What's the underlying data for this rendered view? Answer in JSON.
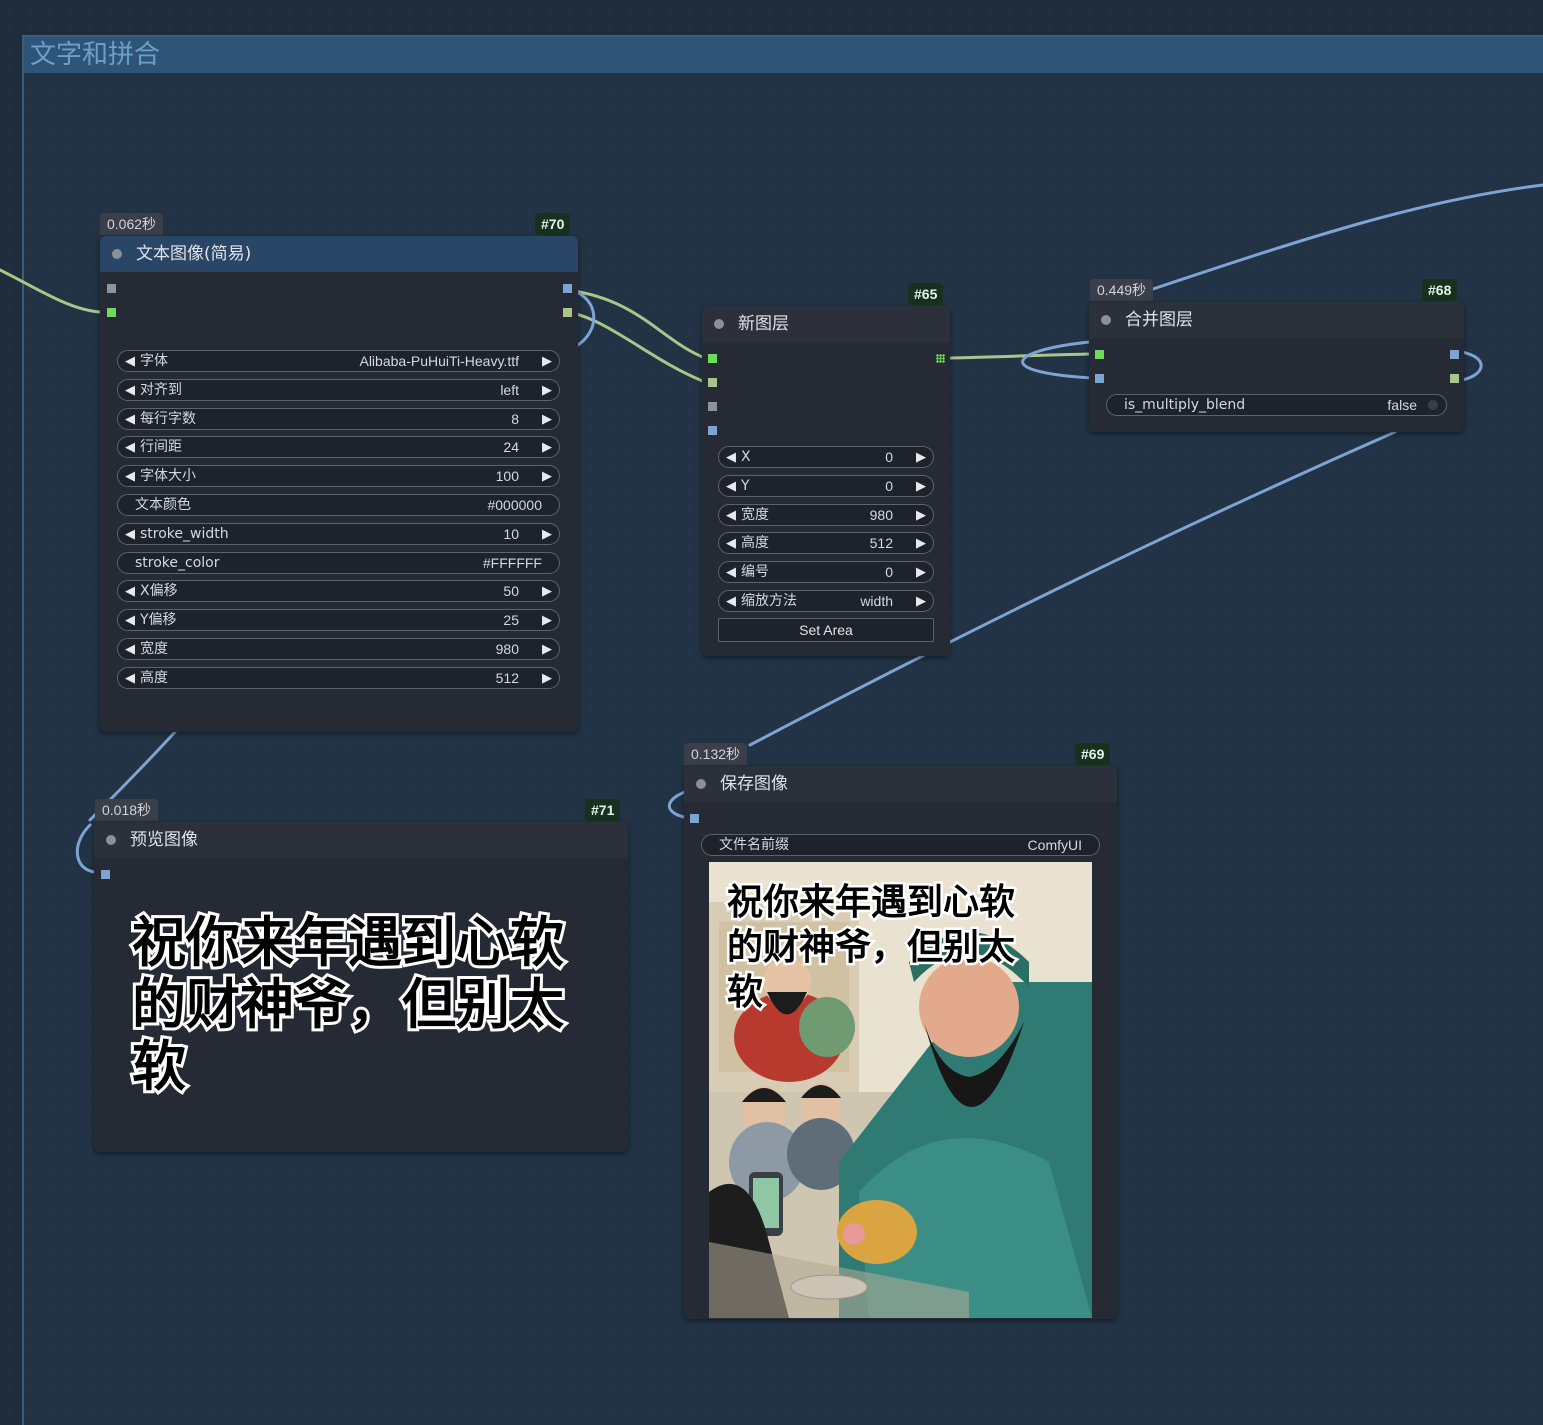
{
  "group": {
    "title": "文字和拼合"
  },
  "colors": {
    "canvas_bg": "#1f2c3b",
    "node_bg": "#252a35",
    "accent_link": "#7ea4d4",
    "image_link": "#a9c58a",
    "mask_link": "#6ddc5a"
  },
  "nodes": {
    "text_image": {
      "time": "0.062秒",
      "id": "#70",
      "title": "文本图像(简易)",
      "widgets": [
        {
          "label": "字体",
          "value": "Alibaba-PuHuiTi-Heavy.ttf"
        },
        {
          "label": "对齐到",
          "value": "left"
        },
        {
          "label": "每行字数",
          "value": "8"
        },
        {
          "label": "行间距",
          "value": "24"
        },
        {
          "label": "字体大小",
          "value": "100"
        },
        {
          "label": "文本颜色",
          "value": "#000000"
        },
        {
          "label": "stroke_width",
          "value": "10"
        },
        {
          "label": "stroke_color",
          "value": "#FFFFFF"
        },
        {
          "label": "X偏移",
          "value": "50"
        },
        {
          "label": "Y偏移",
          "value": "25"
        },
        {
          "label": "宽度",
          "value": "980"
        },
        {
          "label": "高度",
          "value": "512"
        }
      ]
    },
    "new_layer": {
      "id": "#65",
      "title": "新图层",
      "widgets": [
        {
          "label": "X",
          "value": "0"
        },
        {
          "label": "Y",
          "value": "0"
        },
        {
          "label": "宽度",
          "value": "980"
        },
        {
          "label": "高度",
          "value": "512"
        },
        {
          "label": "编号",
          "value": "0"
        },
        {
          "label": "缩放方法",
          "value": "width"
        }
      ],
      "button": "Set Area"
    },
    "merge_layers": {
      "time": "0.449秒",
      "id": "#68",
      "title": "合并图层",
      "toggle": {
        "label": "is_multiply_blend",
        "value": "false"
      }
    },
    "preview_image": {
      "time": "0.018秒",
      "id": "#71",
      "title": "预览图像",
      "text_lines": [
        "祝你来年遇到心软",
        "的财神爷，但别太",
        "软"
      ]
    },
    "save_image": {
      "time": "0.132秒",
      "id": "#69",
      "title": "保存图像",
      "prefix": {
        "label": "文件名前缀",
        "value": "ComfyUI"
      },
      "text_lines": [
        "祝你来年遇到心软",
        "的财神爷，但别太",
        "软"
      ]
    }
  }
}
